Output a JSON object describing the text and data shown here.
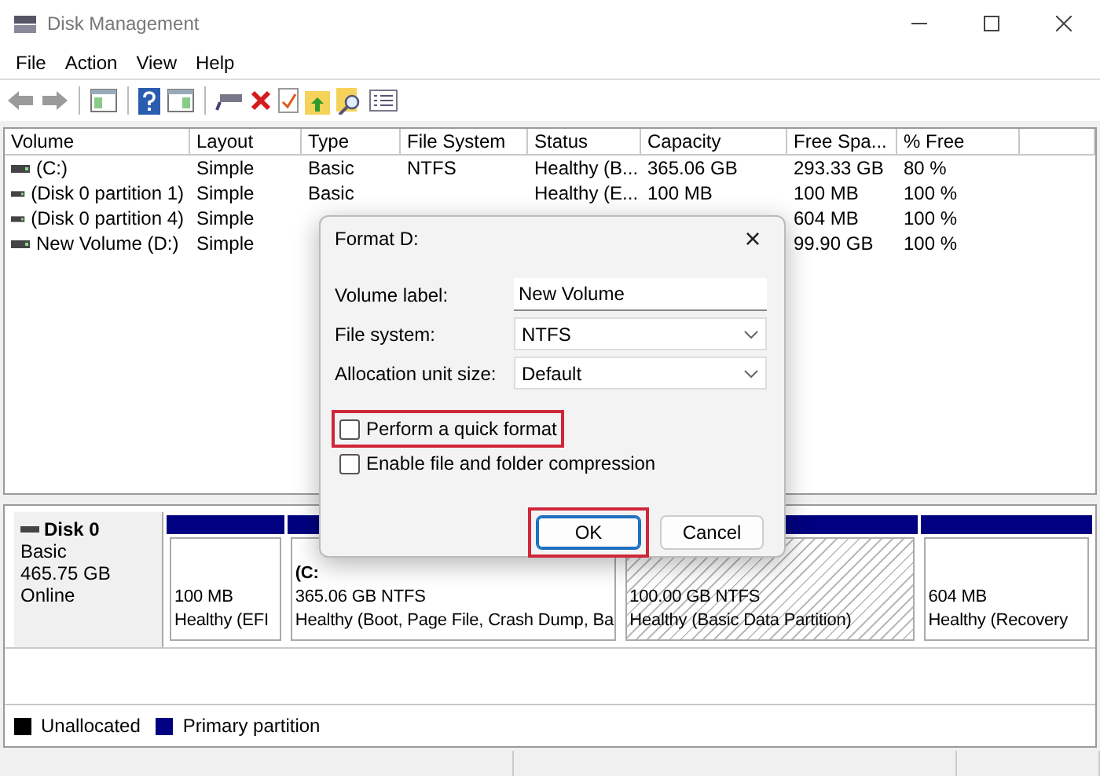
{
  "window": {
    "title": "Disk Management"
  },
  "menu": [
    {
      "label": "File"
    },
    {
      "label": "Action"
    },
    {
      "label": "View"
    },
    {
      "label": "Help"
    }
  ],
  "toolbar": [
    {
      "kind": "back",
      "disabled": true
    },
    {
      "kind": "forward",
      "disabled": true
    },
    {
      "kind": "separator"
    },
    {
      "kind": "tree"
    },
    {
      "kind": "separator"
    },
    {
      "kind": "help"
    },
    {
      "kind": "pane"
    },
    {
      "kind": "separator"
    },
    {
      "kind": "connect"
    },
    {
      "kind": "delete"
    },
    {
      "kind": "properties"
    },
    {
      "kind": "folder-up"
    },
    {
      "kind": "folder-search"
    },
    {
      "kind": "list"
    }
  ],
  "table": {
    "columns": [
      "Volume",
      "Layout",
      "Type",
      "File System",
      "Status",
      "Capacity",
      "Free Spa...",
      "% Free"
    ],
    "rows": [
      {
        "volume": "(C:)",
        "layout": "Simple",
        "type": "Basic",
        "file_system": "NTFS",
        "status": "Healthy (B...",
        "capacity": "365.06 GB",
        "free_space": "293.33 GB",
        "percent_free": "80 %"
      },
      {
        "volume": "(Disk 0 partition 1)",
        "layout": "Simple",
        "type": "Basic",
        "status": "Healthy (E...",
        "capacity": "100 MB",
        "free_space": "100 MB",
        "percent_free": "100 %"
      },
      {
        "volume": "(Disk 0 partition 4)",
        "layout": "Simple",
        "free_space": "604 MB",
        "percent_free": "100 %"
      },
      {
        "volume": "New Volume (D:)",
        "layout": "Simple",
        "free_space": "99.90 GB",
        "percent_free": "100 %"
      }
    ]
  },
  "disk": {
    "name": "Disk 0",
    "type": "Basic",
    "size": "465.75 GB",
    "status": "Online",
    "partitions": [
      {
        "size": "100 MB",
        "status": "Healthy (EFI",
        "selected": false
      },
      {
        "label": "(C:",
        "size": "365.06 GB NTFS",
        "status": "Healthy (Boot, Page File, Crash Dump, Ba",
        "selected": false
      },
      {
        "size": "100.00 GB NTFS",
        "status": "Healthy (Basic Data Partition)",
        "selected": true
      },
      {
        "size": "604 MB",
        "status": "Healthy (Recovery",
        "selected": false
      }
    ]
  },
  "legend": [
    {
      "label": "Unallocated",
      "color": "#000000"
    },
    {
      "label": "Primary partition",
      "color": "#000080"
    }
  ],
  "dialog": {
    "title": "Format D:",
    "close": "×",
    "fields": [
      {
        "kind": "text",
        "label": "Volume label:",
        "value": "New Volume"
      },
      {
        "kind": "dropdown",
        "label": "File system:",
        "value": "NTFS"
      },
      {
        "kind": "dropdown",
        "label": "Allocation unit size:",
        "value": "Default"
      }
    ],
    "checkboxes": [
      {
        "label": "Perform a quick format",
        "checked": false,
        "highlighted": true
      },
      {
        "label": "Enable file and folder compression",
        "checked": false,
        "highlighted": false
      }
    ],
    "buttons": [
      {
        "label": "OK",
        "default": true,
        "highlighted": true
      },
      {
        "label": "Cancel",
        "default": false,
        "highlighted": false
      }
    ]
  }
}
